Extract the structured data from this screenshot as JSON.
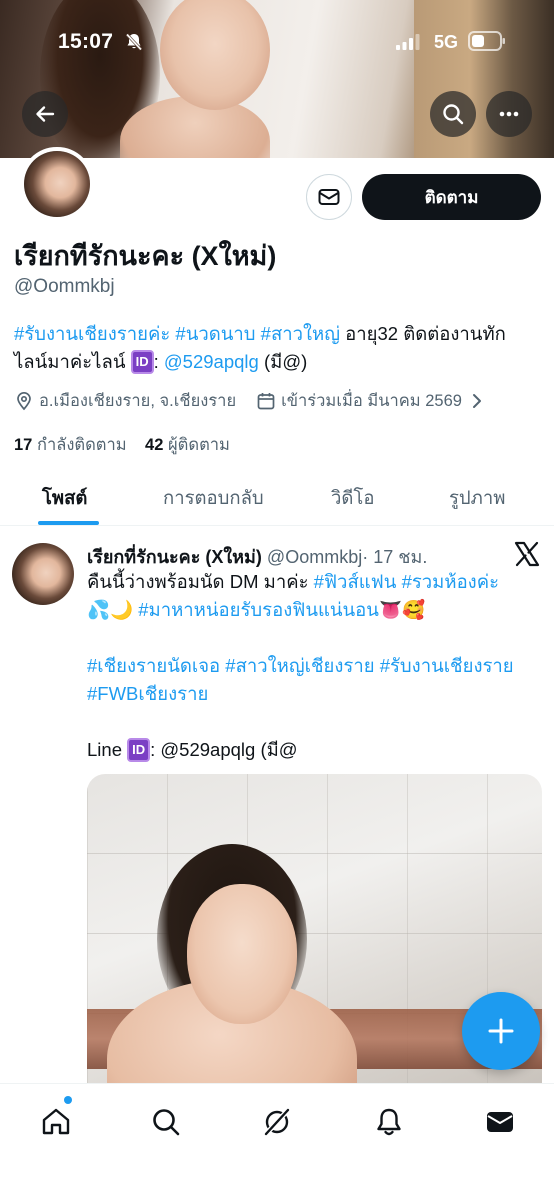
{
  "status_bar": {
    "time": "15:07",
    "network": "5G"
  },
  "profile": {
    "display_name": "เรียกทีรักนะคะ (Xใหม่)",
    "handle": "@Oommkbj",
    "follow_label": "ติดตาม",
    "bio": {
      "tag1": "#รับงานเชียงรายค่ะ",
      "tag2": "#นวดนาบ",
      "tag3": "#สาวใหญ่",
      "text1": " อายุ32 ติดต่องานทักไลน์มาค่ะไลน์ ",
      "id_badge": "ID",
      "colon": ": ",
      "line_id": "@529apqlg",
      "text2": " (มี@)"
    },
    "location": "อ.เมืองเชียงราย, จ.เชียงราย",
    "joined": "เข้าร่วมเมื่อ มีนาคม 2569",
    "following_count": "17",
    "following_label": "กำลังติดตาม",
    "followers_count": "42",
    "followers_label": "ผู้ติดตาม"
  },
  "tabs": [
    {
      "label": "โพสต์",
      "active": true
    },
    {
      "label": "การตอบกลับ",
      "active": false
    },
    {
      "label": "วิดีโอ",
      "active": false
    },
    {
      "label": "รูปภาพ",
      "active": false
    }
  ],
  "post": {
    "author_name": "เรียกที่รักนะคะ (Xใหม่)",
    "author_handle": "@Oommkbj",
    "time": "· 17 ชม.",
    "line1_text": "คืนนี้ว่างพร้อมนัด DM มาค่ะ ",
    "line1_tag1": "#ฟิวส์แฟน",
    "line1_tag2": "#รวมห้องค่ะ",
    "emoji1": "💦🌙",
    "line2_tag": "#มาหาหน่อยรับรองฟินแน่นอน",
    "emoji2": "👅🥰",
    "tags2_a": "#เชียงรายนัดเจอ",
    "tags2_b": "#สาวใหญ่เชียงราย",
    "tags2_c": "#รับงานเชียงราย",
    "tags2_d": "#FWBเชียงราย",
    "line_prefix": "Line ",
    "id_badge": "ID",
    "line_suffix": ": @529apqlg (มี@"
  },
  "colors": {
    "accent": "#1d9bf0",
    "text": "#0f1419",
    "secondary": "#536471"
  },
  "icons": {
    "back": "arrow-left-icon",
    "search": "search-icon",
    "more": "more-icon",
    "message": "envelope-icon",
    "location": "location-pin-icon",
    "calendar": "calendar-icon",
    "compose": "plus-icon"
  }
}
